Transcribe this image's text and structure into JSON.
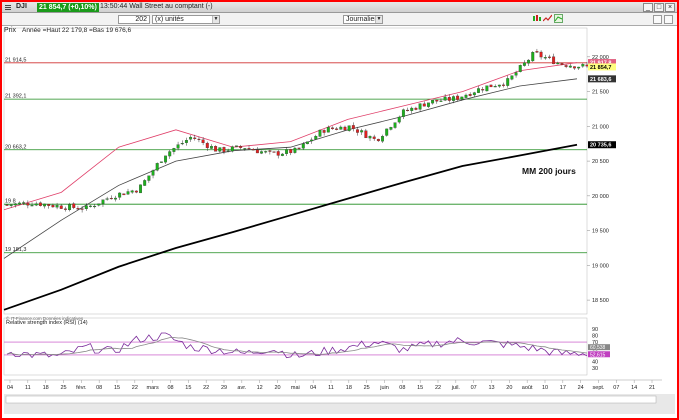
{
  "window": {
    "symbol": "DJI",
    "price_badge": "21 854,7 (+0,10%)",
    "description": "13:50:44 Wall Street au comptant (-)"
  },
  "toolbar": {
    "period_value": "202",
    "period_unit": "(x) unités",
    "interval": "Journalier"
  },
  "price_panel": {
    "label": "Prix",
    "info": "Année =Haut 22 179,8 =Bas 19 676,6",
    "annotation": "MM 200 jours",
    "hlines": [
      {
        "label": "21 914,5",
        "value": 21914.5
      },
      {
        "label": "21 392,1",
        "value": 21392.1
      },
      {
        "label": "20 663,2",
        "value": 20663.2
      },
      {
        "label": "19 8",
        "value": 19880
      },
      {
        "label": "19 181,3",
        "value": 19181.3
      }
    ],
    "yticks": [
      {
        "label": "22 000",
        "value": 22000
      },
      {
        "label": "21 500",
        "value": 21500
      },
      {
        "label": "21 000",
        "value": 21000
      },
      {
        "label": "20 500",
        "value": 20500
      },
      {
        "label": "20 000",
        "value": 20000
      },
      {
        "label": "19 500",
        "value": 19500
      },
      {
        "label": "19 000",
        "value": 19000
      },
      {
        "label": "18 500",
        "value": 18500
      }
    ],
    "right_badges": [
      {
        "label": "21 917,8",
        "value": 21917.8,
        "color": "#e06080"
      },
      {
        "label": "21 854,7",
        "value": 21854.7,
        "color": "#ffff80"
      },
      {
        "label": "21 683,6",
        "value": 21683.6,
        "color": "#333333"
      },
      {
        "label": "20 735,6",
        "value": 20735.6,
        "color": "#000000"
      }
    ],
    "source": "© IT-Finance.com Données indicatives"
  },
  "rsi_panel": {
    "label": "Relative strength index (RSI) (14)",
    "yticks": [
      "90",
      "80",
      "70",
      "60",
      "50",
      "40",
      "30"
    ],
    "badges": [
      "60,538",
      "52,615"
    ]
  },
  "xaxis": {
    "labels": [
      "04",
      "11",
      "18",
      "25",
      "févr.",
      "08",
      "15",
      "22",
      "mars",
      "08",
      "15",
      "22",
      "29",
      "avr.",
      "12",
      "20",
      "mai",
      "04",
      "11",
      "18",
      "25",
      "juin",
      "08",
      "15",
      "22",
      "juil.",
      "07",
      "13",
      "20",
      "août",
      "10",
      "17",
      "24",
      "sept.",
      "07",
      "14",
      "21"
    ]
  },
  "chart_data": {
    "type": "line",
    "title": "",
    "xlabel": "",
    "ylabel": "",
    "ylim": [
      18300,
      22300
    ],
    "series": [
      {
        "name": "MM 200 jours",
        "values": [
          18360,
          18650,
          18980,
          19250,
          19480,
          19720,
          19960,
          20200,
          20430,
          20580,
          20735
        ]
      },
      {
        "name": "",
        "values": [
          19100,
          19650,
          20150,
          20500,
          20650,
          20700,
          20950,
          21150,
          21380,
          21580,
          21684
        ]
      },
      {
        "name": "",
        "values": [
          19800,
          20050,
          20700,
          20950,
          20700,
          20780,
          21100,
          21300,
          21500,
          21800,
          21918
        ]
      }
    ],
    "price_close": [
      19870,
      19900,
      19850,
      19820,
      20000,
      20100,
      20600,
      20850,
      20650,
      20700,
      20600,
      20650,
      20950,
      21000,
      20800,
      21200,
      21350,
      21400,
      21550,
      21650,
      22050,
      21900,
      21855
    ],
    "rsi": [
      55,
      50,
      48,
      62,
      55,
      75,
      80,
      62,
      58,
      52,
      60,
      48,
      55,
      62,
      70,
      58,
      66,
      72,
      70,
      66,
      60,
      52,
      53
    ]
  }
}
